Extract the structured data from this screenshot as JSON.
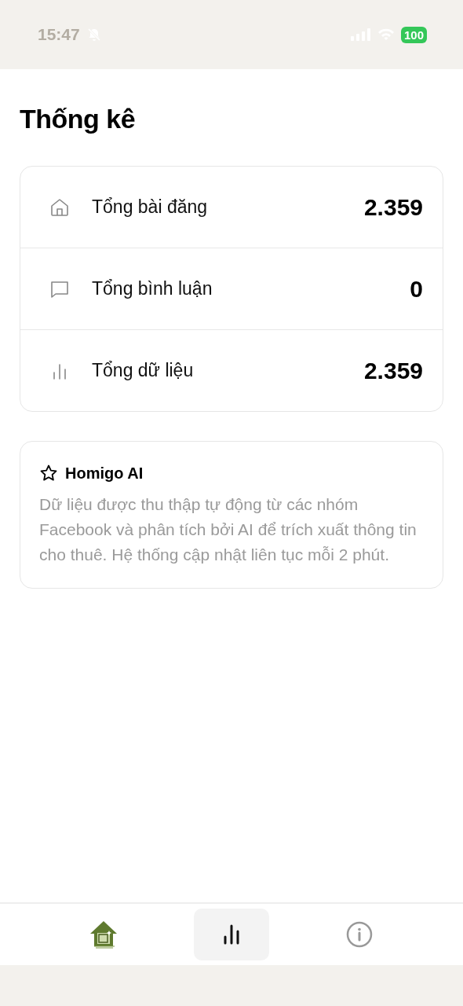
{
  "status_bar": {
    "time": "15:47",
    "battery": "100"
  },
  "title": "Thống kê",
  "stats": [
    {
      "kind": "house",
      "label": "Tổng bài đăng",
      "value": "2.359"
    },
    {
      "kind": "comment",
      "label": "Tổng bình luận",
      "value": "0"
    },
    {
      "kind": "chart",
      "label": "Tổng dữ liệu",
      "value": "2.359"
    }
  ],
  "info": {
    "title": "Homigo AI",
    "text": "Dữ liệu được thu thập tự động từ các nhóm Facebook và phân tích bởi AI để trích xuất thông tin cho thuê. Hệ thống cập nhật liên tục mỗi 2 phút."
  },
  "tabs": [
    {
      "kind": "logo",
      "selected": false
    },
    {
      "kind": "chart",
      "selected": true
    },
    {
      "kind": "info",
      "selected": false
    }
  ]
}
